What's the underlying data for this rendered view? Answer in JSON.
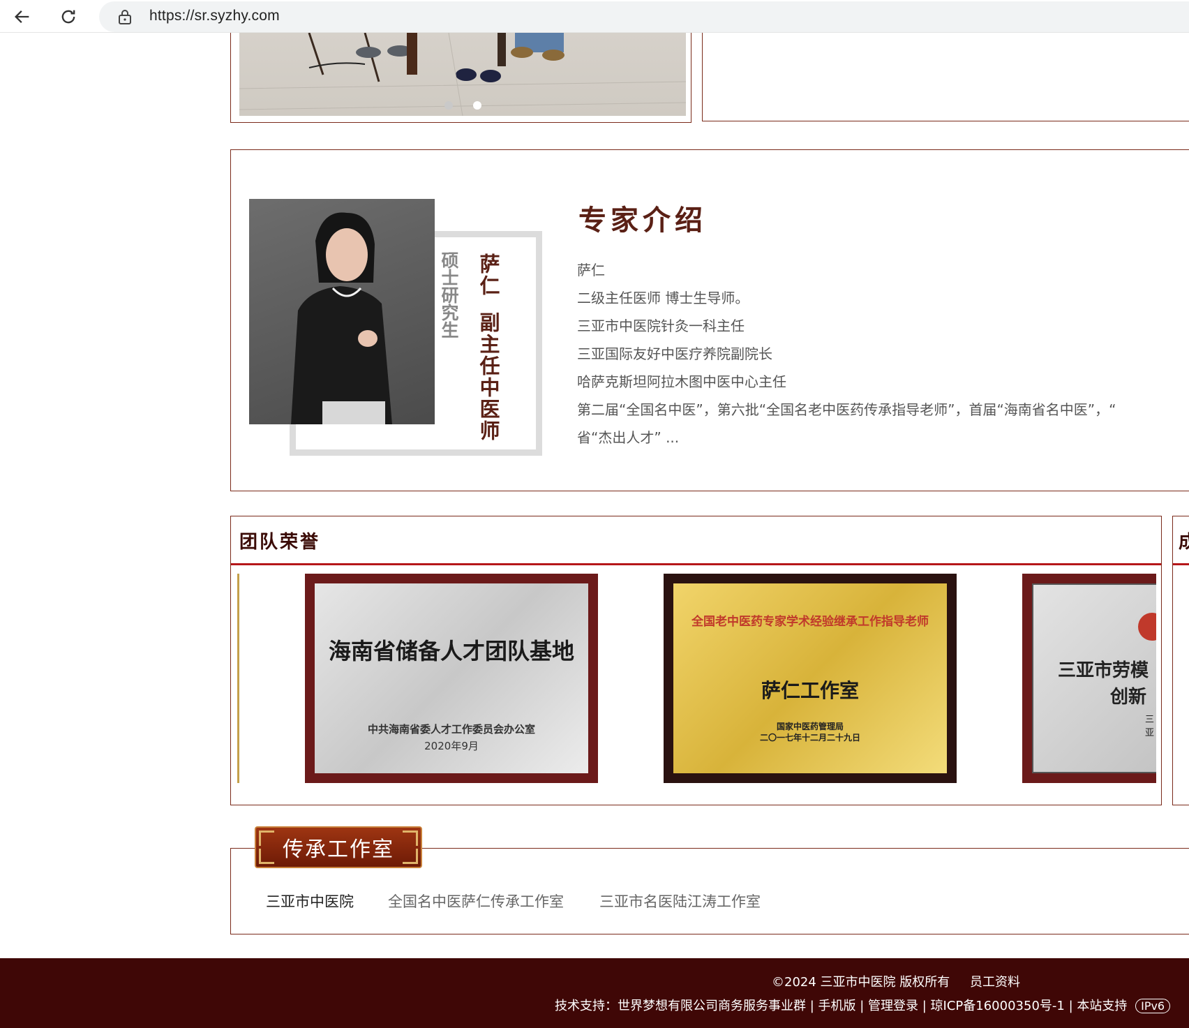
{
  "browser": {
    "url": "https://sr.syzhy.com"
  },
  "expert": {
    "section_title": "专家介绍",
    "portrait_name": "萨仁",
    "portrait_role": "副主任中医师",
    "portrait_degree": "硕士研究生",
    "bio_lines": [
      "萨仁",
      "二级主任医师  博士生导师。",
      "三亚市中医院针灸一科主任",
      "三亚国际友好中医疗养院副院长",
      "哈萨克斯坦阿拉木图中医中心主任",
      "第二届“全国名中医”，第六批“全国名老中医药传承指导老师”，首届“海南省名中医”，“",
      "省“杰出人才”  ..."
    ]
  },
  "honor": {
    "title": "团队荣誉",
    "right_title": "成",
    "plaques": [
      {
        "title": "海南省储备人才团队基地",
        "issuer": "中共海南省委人才工作委员会办公室",
        "date": "2020年9月"
      },
      {
        "arc": "全国老中医药专家学术经验继承工作指导老师",
        "title": "萨仁工作室",
        "issuer": "国家中医药管理局",
        "date": "二〇一七年十二月二十九日"
      },
      {
        "title": "三亚市劳模",
        "subtitle": "创新",
        "issuer": "三亚"
      }
    ]
  },
  "studio": {
    "badge": "传承工作室",
    "links": [
      "三亚市中医院",
      "全国名中医萨仁传承工作室",
      "三亚市名医陆江涛工作室"
    ]
  },
  "footer": {
    "copyright": "©2024 三亚市中医院 版权所有",
    "staff": "员工资料",
    "tech_support": "技术支持：世界梦想有限公司商务服务事业群",
    "mobile": "手机版",
    "admin": "管理登录",
    "icp": "琼ICP备16000350号-1",
    "site_support": "本站支持",
    "ipv6": "IPv6"
  }
}
